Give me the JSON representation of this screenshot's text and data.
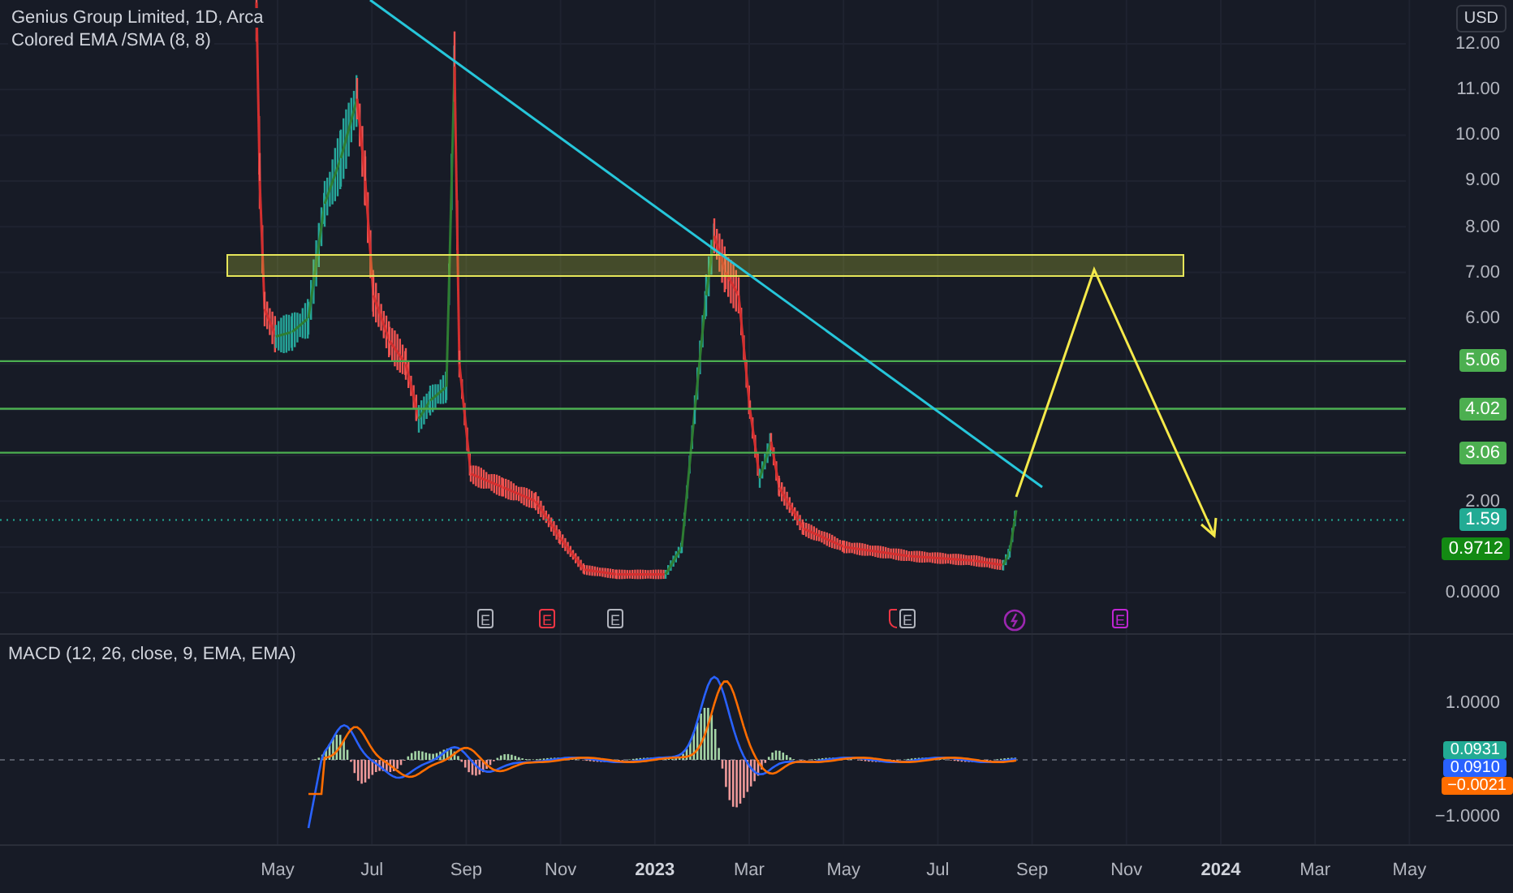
{
  "legend": {
    "symbol": "Genius Group Limited, 1D, Arca",
    "indicator": "Colored EMA /SMA (8, 8)"
  },
  "currency_button": "USD",
  "price_axis": {
    "ticks": [
      "12.00",
      "11.00",
      "10.00",
      "9.00",
      "8.00",
      "7.00",
      "6.00",
      "2.00",
      "0.0000"
    ]
  },
  "price_markers": [
    {
      "label": "5.06",
      "color": "#4caf50"
    },
    {
      "label": "4.02",
      "color": "#4caf50"
    },
    {
      "label": "3.06",
      "color": "#4caf50"
    },
    {
      "label": "1.59",
      "color": "#22ab94"
    },
    {
      "label": "0.9712",
      "color": "#138a13"
    }
  ],
  "events": [
    {
      "kind": "earnings",
      "label": "E",
      "color": "#b2b5be"
    },
    {
      "kind": "earnings",
      "label": "E",
      "color": "#f23645"
    },
    {
      "kind": "earnings",
      "label": "E",
      "color": "#b2b5be"
    },
    {
      "kind": "flag",
      "color": "#f23645"
    },
    {
      "kind": "earnings",
      "label": "E",
      "color": "#b2b5be"
    },
    {
      "kind": "split",
      "color": "#9c27b0"
    },
    {
      "kind": "earnings",
      "label": "E",
      "color": "#c026d3"
    }
  ],
  "macd": {
    "legend": "MACD (12, 26, close, 9, EMA, EMA)",
    "ticks": [
      "1.0000",
      "−1.0000"
    ],
    "markers": [
      {
        "label": "0.0931",
        "color": "#22ab94"
      },
      {
        "label": "0.0910",
        "color": "#2962ff"
      },
      {
        "label": "−0.0021",
        "color": "#ff6d00"
      }
    ]
  },
  "time_axis": [
    {
      "label": "May",
      "kind": "month"
    },
    {
      "label": "Jul",
      "kind": "month"
    },
    {
      "label": "Sep",
      "kind": "month"
    },
    {
      "label": "Nov",
      "kind": "month"
    },
    {
      "label": "2023",
      "kind": "year"
    },
    {
      "label": "Mar",
      "kind": "month"
    },
    {
      "label": "May",
      "kind": "month"
    },
    {
      "label": "Jul",
      "kind": "month"
    },
    {
      "label": "Sep",
      "kind": "month"
    },
    {
      "label": "Nov",
      "kind": "month"
    },
    {
      "label": "2024",
      "kind": "year"
    },
    {
      "label": "Mar",
      "kind": "month"
    },
    {
      "label": "May",
      "kind": "month"
    }
  ]
}
